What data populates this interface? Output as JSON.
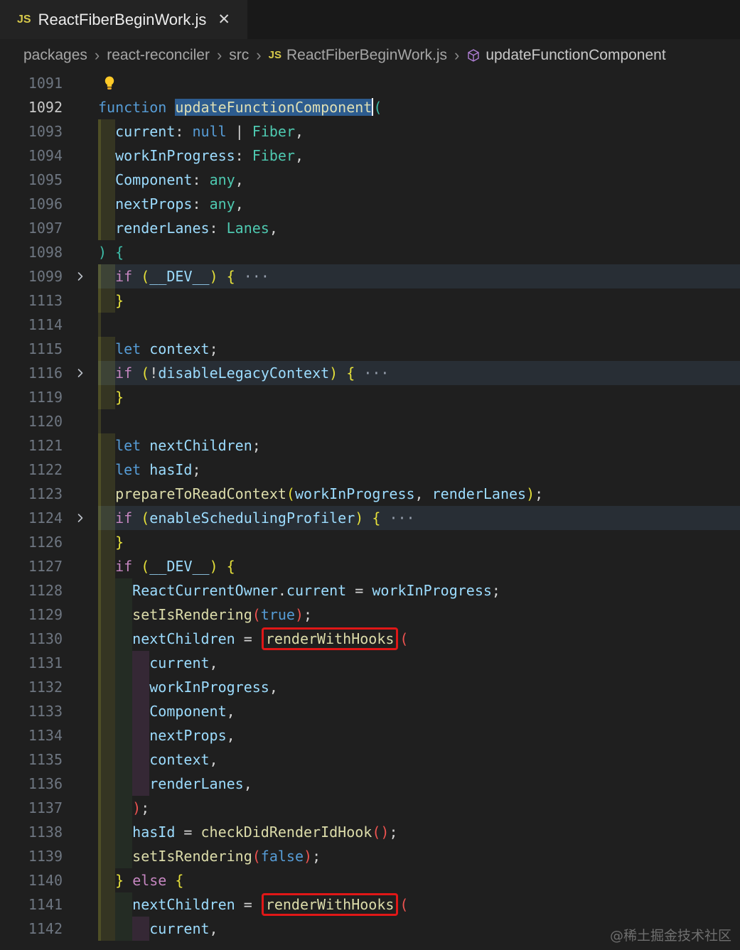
{
  "tab": {
    "icon": "JS",
    "title": "ReactFiberBeginWork.js",
    "close": "✕"
  },
  "breadcrumb": {
    "separator": "›",
    "items": [
      {
        "label": "packages",
        "icon": null
      },
      {
        "label": "react-reconciler",
        "icon": null
      },
      {
        "label": "src",
        "icon": null
      },
      {
        "label": "ReactFiberBeginWork.js",
        "icon": "js"
      },
      {
        "label": "updateFunctionComponent",
        "icon": "symbol-function"
      }
    ]
  },
  "watermark": "@稀土掘金技术社区",
  "colors": {
    "editor_bg": "#1f1f1f",
    "tabstrip_bg": "#191919",
    "tab_bg": "#232323",
    "selection_bg": "#2d5c8f",
    "fold_line_bg": "rgba(96,139,193,0.14)",
    "annotation_box": "#e01717",
    "bracket_depth1": "#3dbda9",
    "bracket_depth2": "#e5e03a",
    "bracket_depth3": "#ee5350",
    "indent_bars": [
      "rgba(255,255,64,0.10)",
      "rgba(127,255,127,0.06)",
      "rgba(255,127,255,0.10)"
    ]
  },
  "editor": {
    "lines": [
      {
        "n": "1091",
        "chev": false,
        "fold": false,
        "bars": 0,
        "guide": false,
        "active": false,
        "tokens": [
          [
            "bulb",
            ""
          ]
        ]
      },
      {
        "n": "1092",
        "chev": false,
        "fold": false,
        "bars": 0,
        "guide": false,
        "active": true,
        "tokens": [
          [
            "kw",
            "function"
          ],
          [
            "pun",
            " "
          ],
          [
            "selfn",
            "updateFunctionComponent"
          ],
          [
            "caret",
            ""
          ],
          [
            "b1",
            "("
          ]
        ]
      },
      {
        "n": "1093",
        "chev": false,
        "fold": false,
        "bars": 1,
        "guide": true,
        "active": false,
        "tokens": [
          [
            "pun",
            "  "
          ],
          [
            "var",
            "current"
          ],
          [
            "pun",
            ": "
          ],
          [
            "kw",
            "null"
          ],
          [
            "pun",
            " | "
          ],
          [
            "typ",
            "Fiber"
          ],
          [
            "pun",
            ","
          ]
        ]
      },
      {
        "n": "1094",
        "chev": false,
        "fold": false,
        "bars": 1,
        "guide": true,
        "active": false,
        "tokens": [
          [
            "pun",
            "  "
          ],
          [
            "var",
            "workInProgress"
          ],
          [
            "pun",
            ": "
          ],
          [
            "typ",
            "Fiber"
          ],
          [
            "pun",
            ","
          ]
        ]
      },
      {
        "n": "1095",
        "chev": false,
        "fold": false,
        "bars": 1,
        "guide": true,
        "active": false,
        "tokens": [
          [
            "pun",
            "  "
          ],
          [
            "var",
            "Component"
          ],
          [
            "pun",
            ": "
          ],
          [
            "typ",
            "any"
          ],
          [
            "pun",
            ","
          ]
        ]
      },
      {
        "n": "1096",
        "chev": false,
        "fold": false,
        "bars": 1,
        "guide": true,
        "active": false,
        "tokens": [
          [
            "pun",
            "  "
          ],
          [
            "var",
            "nextProps"
          ],
          [
            "pun",
            ": "
          ],
          [
            "typ",
            "any"
          ],
          [
            "pun",
            ","
          ]
        ]
      },
      {
        "n": "1097",
        "chev": false,
        "fold": false,
        "bars": 1,
        "guide": true,
        "active": false,
        "tokens": [
          [
            "pun",
            "  "
          ],
          [
            "var",
            "renderLanes"
          ],
          [
            "pun",
            ": "
          ],
          [
            "typ",
            "Lanes"
          ],
          [
            "pun",
            ","
          ]
        ]
      },
      {
        "n": "1098",
        "chev": false,
        "fold": false,
        "bars": 0,
        "guide": false,
        "active": false,
        "tokens": [
          [
            "b1",
            ")"
          ],
          [
            "pun",
            " "
          ],
          [
            "b1",
            "{"
          ]
        ]
      },
      {
        "n": "1099",
        "chev": true,
        "fold": true,
        "bars": 1,
        "guide": true,
        "active": false,
        "tokens": [
          [
            "pun",
            "  "
          ],
          [
            "ctl",
            "if"
          ],
          [
            "pun",
            " "
          ],
          [
            "b2",
            "("
          ],
          [
            "var",
            "__DEV__"
          ],
          [
            "b2",
            ")"
          ],
          [
            "pun",
            " "
          ],
          [
            "b2",
            "{"
          ],
          [
            "pun",
            " "
          ],
          [
            "dots",
            "···"
          ]
        ]
      },
      {
        "n": "1113",
        "chev": false,
        "fold": false,
        "bars": 1,
        "guide": true,
        "active": false,
        "tokens": [
          [
            "pun",
            "  "
          ],
          [
            "b2",
            "}"
          ]
        ]
      },
      {
        "n": "1114",
        "chev": false,
        "fold": false,
        "bars": 0,
        "guide": true,
        "active": false,
        "tokens": []
      },
      {
        "n": "1115",
        "chev": false,
        "fold": false,
        "bars": 1,
        "guide": true,
        "active": false,
        "tokens": [
          [
            "pun",
            "  "
          ],
          [
            "kw",
            "let"
          ],
          [
            "pun",
            " "
          ],
          [
            "var",
            "context"
          ],
          [
            "pun",
            ";"
          ]
        ]
      },
      {
        "n": "1116",
        "chev": true,
        "fold": true,
        "bars": 1,
        "guide": true,
        "active": false,
        "tokens": [
          [
            "pun",
            "  "
          ],
          [
            "ctl",
            "if"
          ],
          [
            "pun",
            " "
          ],
          [
            "b2",
            "("
          ],
          [
            "pun",
            "!"
          ],
          [
            "var",
            "disableLegacyContext"
          ],
          [
            "b2",
            ")"
          ],
          [
            "pun",
            " "
          ],
          [
            "b2",
            "{"
          ],
          [
            "pun",
            " "
          ],
          [
            "dots",
            "···"
          ]
        ]
      },
      {
        "n": "1119",
        "chev": false,
        "fold": false,
        "bars": 1,
        "guide": true,
        "active": false,
        "tokens": [
          [
            "pun",
            "  "
          ],
          [
            "b2",
            "}"
          ]
        ]
      },
      {
        "n": "1120",
        "chev": false,
        "fold": false,
        "bars": 0,
        "guide": true,
        "active": false,
        "tokens": []
      },
      {
        "n": "1121",
        "chev": false,
        "fold": false,
        "bars": 1,
        "guide": true,
        "active": false,
        "tokens": [
          [
            "pun",
            "  "
          ],
          [
            "kw",
            "let"
          ],
          [
            "pun",
            " "
          ],
          [
            "var",
            "nextChildren"
          ],
          [
            "pun",
            ";"
          ]
        ]
      },
      {
        "n": "1122",
        "chev": false,
        "fold": false,
        "bars": 1,
        "guide": true,
        "active": false,
        "tokens": [
          [
            "pun",
            "  "
          ],
          [
            "kw",
            "let"
          ],
          [
            "pun",
            " "
          ],
          [
            "var",
            "hasId"
          ],
          [
            "pun",
            ";"
          ]
        ]
      },
      {
        "n": "1123",
        "chev": false,
        "fold": false,
        "bars": 1,
        "guide": true,
        "active": false,
        "tokens": [
          [
            "pun",
            "  "
          ],
          [
            "fn",
            "prepareToReadContext"
          ],
          [
            "b2",
            "("
          ],
          [
            "var",
            "workInProgress"
          ],
          [
            "pun",
            ", "
          ],
          [
            "var",
            "renderLanes"
          ],
          [
            "b2",
            ")"
          ],
          [
            "pun",
            ";"
          ]
        ]
      },
      {
        "n": "1124",
        "chev": true,
        "fold": true,
        "bars": 1,
        "guide": true,
        "active": false,
        "tokens": [
          [
            "pun",
            "  "
          ],
          [
            "ctl",
            "if"
          ],
          [
            "pun",
            " "
          ],
          [
            "b2",
            "("
          ],
          [
            "var",
            "enableSchedulingProfiler"
          ],
          [
            "b2",
            ")"
          ],
          [
            "pun",
            " "
          ],
          [
            "b2",
            "{"
          ],
          [
            "pun",
            " "
          ],
          [
            "dots",
            "···"
          ]
        ]
      },
      {
        "n": "1126",
        "chev": false,
        "fold": false,
        "bars": 1,
        "guide": true,
        "active": false,
        "tokens": [
          [
            "pun",
            "  "
          ],
          [
            "b2",
            "}"
          ]
        ]
      },
      {
        "n": "1127",
        "chev": false,
        "fold": false,
        "bars": 1,
        "guide": true,
        "active": false,
        "tokens": [
          [
            "pun",
            "  "
          ],
          [
            "ctl",
            "if"
          ],
          [
            "pun",
            " "
          ],
          [
            "b2",
            "("
          ],
          [
            "var",
            "__DEV__"
          ],
          [
            "b2",
            ")"
          ],
          [
            "pun",
            " "
          ],
          [
            "b2",
            "{"
          ]
        ]
      },
      {
        "n": "1128",
        "chev": false,
        "fold": false,
        "bars": 2,
        "guide": true,
        "active": false,
        "tokens": [
          [
            "pun",
            "    "
          ],
          [
            "var",
            "ReactCurrentOwner"
          ],
          [
            "pun",
            "."
          ],
          [
            "var",
            "current"
          ],
          [
            "pun",
            " = "
          ],
          [
            "var",
            "workInProgress"
          ],
          [
            "pun",
            ";"
          ]
        ]
      },
      {
        "n": "1129",
        "chev": false,
        "fold": false,
        "bars": 2,
        "guide": true,
        "active": false,
        "tokens": [
          [
            "pun",
            "    "
          ],
          [
            "fn",
            "setIsRendering"
          ],
          [
            "b3",
            "("
          ],
          [
            "kw",
            "true"
          ],
          [
            "b3",
            ")"
          ],
          [
            "pun",
            ";"
          ]
        ]
      },
      {
        "n": "1130",
        "chev": false,
        "fold": false,
        "bars": 2,
        "guide": true,
        "active": false,
        "tokens": [
          [
            "pun",
            "    "
          ],
          [
            "var",
            "nextChildren"
          ],
          [
            "pun",
            " = "
          ],
          [
            "boxfn",
            "renderWithHooks"
          ],
          [
            "b3",
            "("
          ]
        ]
      },
      {
        "n": "1131",
        "chev": false,
        "fold": false,
        "bars": 3,
        "guide": true,
        "active": false,
        "tokens": [
          [
            "pun",
            "      "
          ],
          [
            "var",
            "current"
          ],
          [
            "pun",
            ","
          ]
        ]
      },
      {
        "n": "1132",
        "chev": false,
        "fold": false,
        "bars": 3,
        "guide": true,
        "active": false,
        "tokens": [
          [
            "pun",
            "      "
          ],
          [
            "var",
            "workInProgress"
          ],
          [
            "pun",
            ","
          ]
        ]
      },
      {
        "n": "1133",
        "chev": false,
        "fold": false,
        "bars": 3,
        "guide": true,
        "active": false,
        "tokens": [
          [
            "pun",
            "      "
          ],
          [
            "var",
            "Component"
          ],
          [
            "pun",
            ","
          ]
        ]
      },
      {
        "n": "1134",
        "chev": false,
        "fold": false,
        "bars": 3,
        "guide": true,
        "active": false,
        "tokens": [
          [
            "pun",
            "      "
          ],
          [
            "var",
            "nextProps"
          ],
          [
            "pun",
            ","
          ]
        ]
      },
      {
        "n": "1135",
        "chev": false,
        "fold": false,
        "bars": 3,
        "guide": true,
        "active": false,
        "tokens": [
          [
            "pun",
            "      "
          ],
          [
            "var",
            "context"
          ],
          [
            "pun",
            ","
          ]
        ]
      },
      {
        "n": "1136",
        "chev": false,
        "fold": false,
        "bars": 3,
        "guide": true,
        "active": false,
        "tokens": [
          [
            "pun",
            "      "
          ],
          [
            "var",
            "renderLanes"
          ],
          [
            "pun",
            ","
          ]
        ]
      },
      {
        "n": "1137",
        "chev": false,
        "fold": false,
        "bars": 2,
        "guide": true,
        "active": false,
        "tokens": [
          [
            "pun",
            "    "
          ],
          [
            "b3",
            ")"
          ],
          [
            "pun",
            ";"
          ]
        ]
      },
      {
        "n": "1138",
        "chev": false,
        "fold": false,
        "bars": 2,
        "guide": true,
        "active": false,
        "tokens": [
          [
            "pun",
            "    "
          ],
          [
            "var",
            "hasId"
          ],
          [
            "pun",
            " = "
          ],
          [
            "fn",
            "checkDidRenderIdHook"
          ],
          [
            "b3",
            "()"
          ],
          [
            "pun",
            ";"
          ]
        ]
      },
      {
        "n": "1139",
        "chev": false,
        "fold": false,
        "bars": 2,
        "guide": true,
        "active": false,
        "tokens": [
          [
            "pun",
            "    "
          ],
          [
            "fn",
            "setIsRendering"
          ],
          [
            "b3",
            "("
          ],
          [
            "kw",
            "false"
          ],
          [
            "b3",
            ")"
          ],
          [
            "pun",
            ";"
          ]
        ]
      },
      {
        "n": "1140",
        "chev": false,
        "fold": false,
        "bars": 1,
        "guide": true,
        "active": false,
        "tokens": [
          [
            "pun",
            "  "
          ],
          [
            "b2",
            "}"
          ],
          [
            "pun",
            " "
          ],
          [
            "ctl",
            "else"
          ],
          [
            "pun",
            " "
          ],
          [
            "b2",
            "{"
          ]
        ]
      },
      {
        "n": "1141",
        "chev": false,
        "fold": false,
        "bars": 2,
        "guide": true,
        "active": false,
        "tokens": [
          [
            "pun",
            "    "
          ],
          [
            "var",
            "nextChildren"
          ],
          [
            "pun",
            " = "
          ],
          [
            "boxfn",
            "renderWithHooks"
          ],
          [
            "b3",
            "("
          ]
        ]
      },
      {
        "n": "1142",
        "chev": false,
        "fold": false,
        "bars": 3,
        "guide": true,
        "active": false,
        "tokens": [
          [
            "pun",
            "      "
          ],
          [
            "var",
            "current"
          ],
          [
            "pun",
            ","
          ]
        ]
      }
    ]
  }
}
